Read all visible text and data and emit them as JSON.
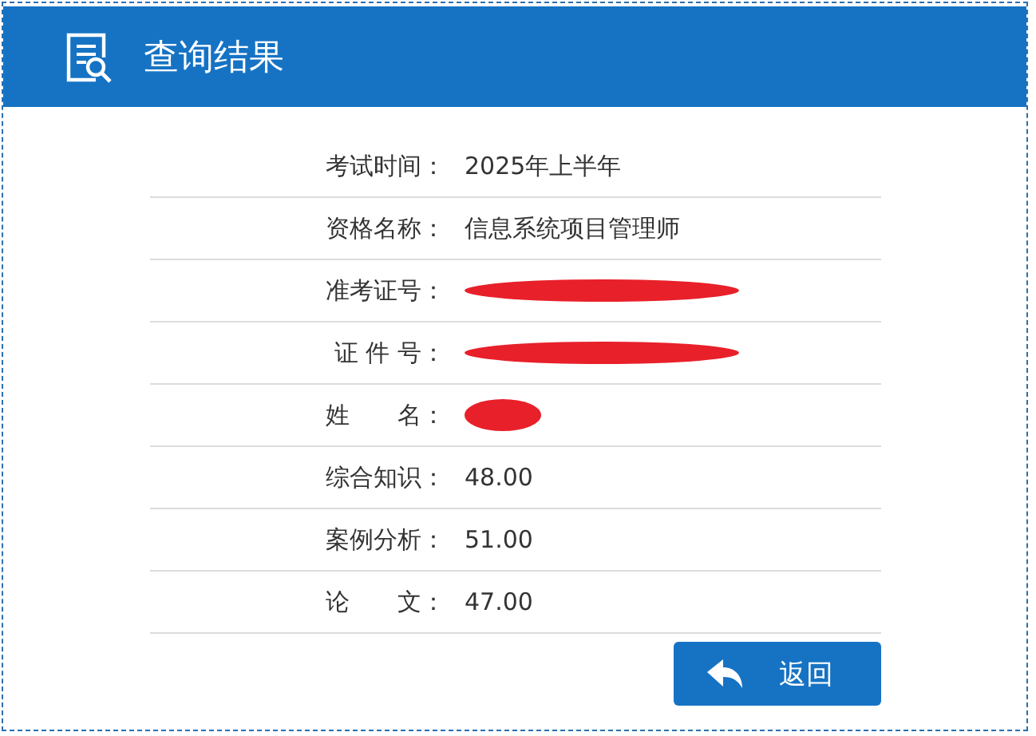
{
  "header": {
    "title": "查询结果"
  },
  "rows": [
    {
      "label": "考试时间：",
      "value": "2025年上半年"
    },
    {
      "label": "资格名称：",
      "value": "信息系统项目管理师"
    },
    {
      "label": "准考证号：",
      "redacted": true,
      "wide": true
    },
    {
      "label": "证 件 号：",
      "redacted": true,
      "wide": true
    },
    {
      "label": "姓　　名：",
      "redacted": true,
      "wide": false
    },
    {
      "label": "综合知识：",
      "value": "48.00"
    },
    {
      "label": "案例分析：",
      "value": "51.00"
    },
    {
      "label": "论　　文：",
      "value": "47.00"
    }
  ],
  "buttons": [
    {
      "label": "返回"
    }
  ]
}
